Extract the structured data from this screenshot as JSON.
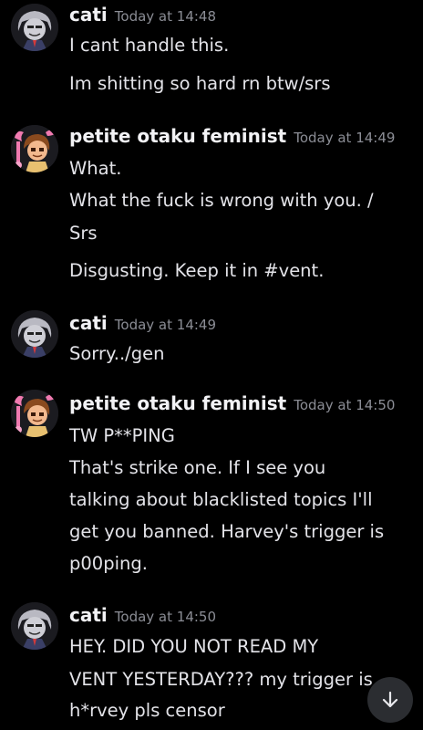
{
  "messages": [
    {
      "author": "cati",
      "avatar_icon": "cati-avatar-icon",
      "timestamp": "Today at 14:48",
      "lines": [
        "I cant handle this.",
        "Im shitting so hard rn btw/srs"
      ]
    },
    {
      "author": "petite otaku feminist",
      "avatar_icon": "feminist-avatar-icon",
      "timestamp": "Today at 14:49",
      "lines": [
        "What.",
        "What the fuck is wrong with you. /",
        "Srs",
        "Disgusting. Keep it in #vent."
      ]
    },
    {
      "author": "cati",
      "avatar_icon": "cati-avatar-icon",
      "timestamp": "Today at 14:49",
      "lines": [
        "Sorry../gen"
      ]
    },
    {
      "author": "petite otaku feminist",
      "avatar_icon": "feminist-avatar-icon",
      "timestamp": "Today at 14:50",
      "lines": [
        "TW P**PING",
        "That's strike one. If I see you",
        "talking about blacklisted topics I'll",
        "get you banned. Harvey's trigger is",
        "p00ping."
      ]
    },
    {
      "author": "cati",
      "avatar_icon": "cati-avatar-icon",
      "timestamp": "Today at 14:50",
      "lines": [
        "HEY. DID YOU NOT READ MY",
        "VENT YESTERDAY??? my trigger is",
        "h*rvey pls censor"
      ]
    }
  ],
  "scroll_button_icon": "arrow-down-icon",
  "colors": {
    "background": "#000000",
    "author": "#f2f2f5",
    "timestamp": "#8b8d95",
    "text": "#e3e3e8",
    "scroll_button": "#2b2d31"
  }
}
